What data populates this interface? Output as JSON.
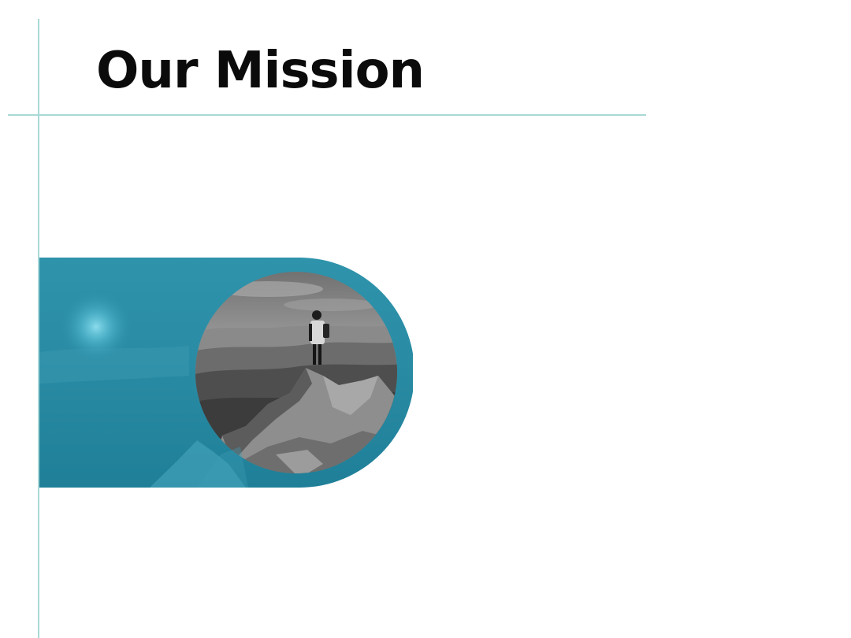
{
  "slide": {
    "title": "Our Mission"
  },
  "colors": {
    "accent_line": "#a8d8d6",
    "banner_teal": "#2b8fa6",
    "banner_teal_dark": "#1d7d95",
    "title_text": "#0b0b0b"
  },
  "icons": {
    "photo": "hiker-on-mountain-photo"
  }
}
